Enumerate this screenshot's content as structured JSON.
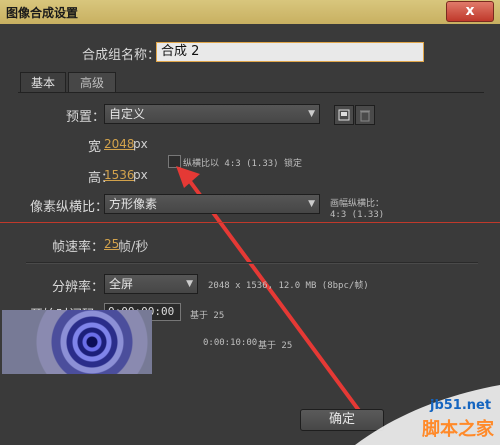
{
  "window": {
    "title": "图像合成设置",
    "close_label": "x"
  },
  "form": {
    "name_label": "合成组名称：",
    "name_value": "合成 2",
    "tabs": [
      "基本",
      "高级"
    ],
    "preset_label": "预置：",
    "preset_value": "自定义",
    "width_label": "宽",
    "width_value": "2048",
    "height_label": "高：",
    "height_value": "1536",
    "unit_px": "px",
    "lock_label": "纵横比以 4:3 (1.33) 锁定",
    "pixel_aspect_label": "像素纵横比：",
    "pixel_aspect_value": "方形像素",
    "frame_aspect_label": "画幅纵横比：",
    "frame_aspect_value": "4:3 (1.33)",
    "fps_label": "帧速率：",
    "fps_value": "25",
    "fps_unit": "帧/秒",
    "resolution_label": "分辨率：",
    "resolution_value": "全屏",
    "resolution_info": "2048 x 1536, 12.0 MB (8bpc/帧)",
    "start_label": "开始时间码：",
    "start_value": "0:00:00:00",
    "start_base": "基于 25",
    "duration_value": "0:00:10:00",
    "duration_base": "基于 25",
    "ok_label": "确定"
  },
  "watermark": {
    "site": "jb51.net",
    "brand": "脚本之家"
  },
  "colors": {
    "accent": "#d2a24c",
    "annotation": "#e53935",
    "titlebar": "#d4bf6e"
  }
}
